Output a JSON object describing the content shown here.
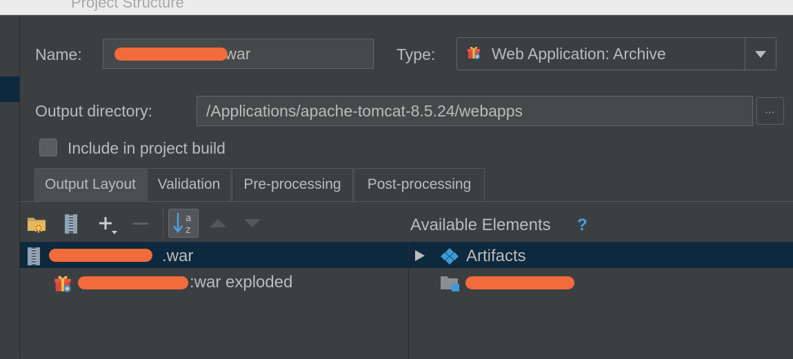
{
  "window": {
    "title": "Project Structure"
  },
  "form": {
    "name_label": "Name:",
    "name_value_visible": ":war",
    "type_label": "Type:",
    "type_value": "Web Application: Archive",
    "output_dir_label": "Output directory:",
    "output_dir_value": "/Applications/apache-tomcat-8.5.24/webapps",
    "browse_label": "...",
    "include_label": "Include in project build",
    "include_checked": false
  },
  "tabs": [
    {
      "label": "Output Layout",
      "active": true
    },
    {
      "label": "Validation",
      "active": false
    },
    {
      "label": "Pre-processing",
      "active": false
    },
    {
      "label": "Post-processing",
      "active": false
    }
  ],
  "layout_tree": [
    {
      "label": ".war",
      "icon": "archive-icon",
      "selected": true
    },
    {
      "label": ":war exploded",
      "icon": "gift-icon",
      "selected": false
    }
  ],
  "available": {
    "title": "Available Elements",
    "help": "?",
    "items": [
      {
        "label": "Artifacts",
        "icon": "artifacts-icon",
        "selected": true
      },
      {
        "label": "",
        "icon": "module-folder-icon",
        "selected": false
      }
    ]
  },
  "colors": {
    "background": "#3c3f41",
    "selection": "#0d293e",
    "redaction": "#f26b3a",
    "help_blue": "#4a9fe0"
  }
}
